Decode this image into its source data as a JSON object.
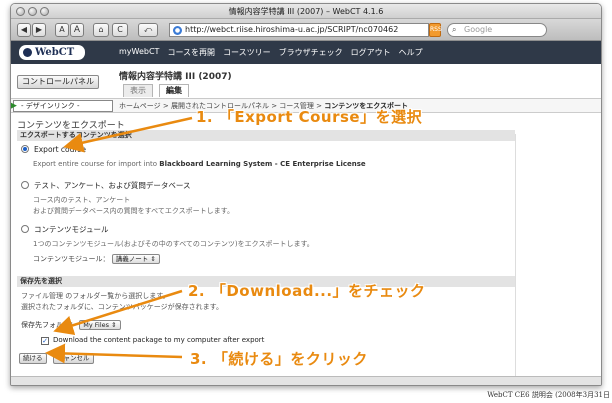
{
  "window": {
    "title": "情報内容学特講 III (2007) – WebCT 4.1.6"
  },
  "toolbar": {
    "back": "◀",
    "forward": "▶",
    "text_small": "A",
    "text_large": "A",
    "home": "⌂",
    "reload": "C",
    "url": "http://webct.riise.hiroshima-u.ac.jp/SCRIPT/nc070462",
    "rss": "RSS",
    "search_placeholder": "Google"
  },
  "webct": {
    "logo": "WebCT",
    "nav": [
      "myWebCT",
      "コースを再開",
      "コースツリー",
      "ブラウザチェック",
      "ログアウト",
      "ヘルプ"
    ]
  },
  "header": {
    "control_panel": "コントロールパネル",
    "course_title": "情報内容学特講 III (2007)",
    "tabs": [
      "表示",
      "編集"
    ]
  },
  "crumbs": {
    "design_link": "- デザインリンク -",
    "path": "ホームページ > 展開されたコントロールパネル > コース管理 > ",
    "current": "コンテンツをエクスポート"
  },
  "page": {
    "heading": "コンテンツをエクスポート",
    "section_export": "エクスポートするコンテンツを選択",
    "opt_course": "Export course",
    "opt_course_desc_pre": "Export entire course for import into ",
    "opt_course_desc_bold": "Blackboard Learning System - CE Enterprise License",
    "opt_tests": "テスト、アンケート、および質問データベース",
    "opt_tests_desc1": "コース内のテスト、アンケート",
    "opt_tests_desc2": "および質問データベース内の質問をすべてエクスポートします。",
    "opt_module": "コンテンツモジュール",
    "opt_module_desc": "1つのコンテンツモジュール(およびその中のすべてのコンテンツ)をエクスポートします。",
    "module_label": "コンテンツモジュール：",
    "module_select": "講義ノート ⇕",
    "section_dest": "保存先を選択",
    "dest_desc1": "ファイル管理 のフォルダー覧から選択します。",
    "dest_desc2": "選択されたフォルダに、コンテンツパッケージが保存されます。",
    "folder_label": "保存先フォルダ：",
    "folder_select": "My Files ⇕",
    "download_label": "Download the content package to my computer after export",
    "continue_btn": "続ける",
    "cancel_btn": "キャンセル"
  },
  "annotations": {
    "step1": "1. 「Export Course」を選択",
    "step2": "2. 「Download...」をチェック",
    "step3": "3. 「続ける」をクリック"
  },
  "footer": "WebCT CE6 説明会 (2008年3月31日",
  "colors": {
    "annotation": "#e98a10",
    "webct_bar": "#2f3948"
  }
}
